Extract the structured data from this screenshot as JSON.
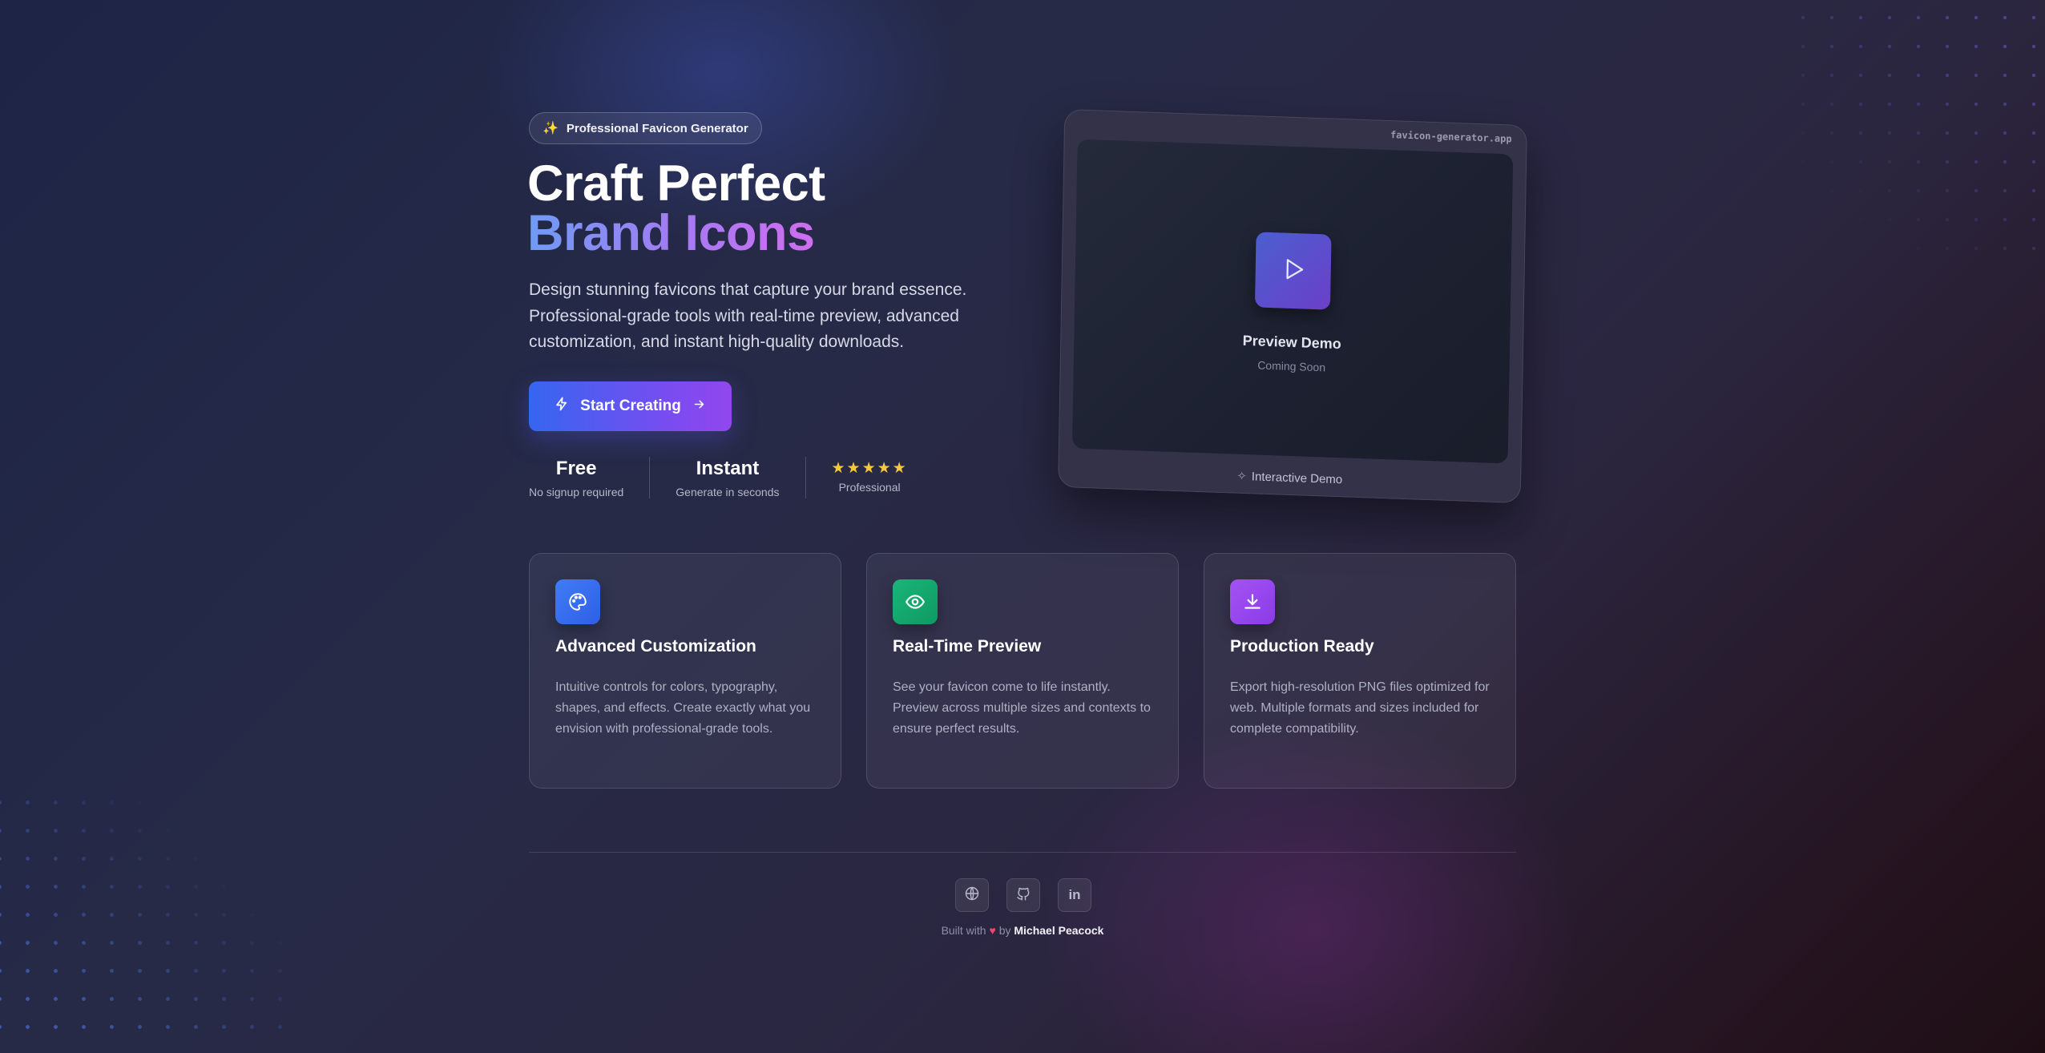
{
  "badge": {
    "icon": "sparkles-icon",
    "label": "Professional Favicon Generator"
  },
  "hero": {
    "title_line1": "Craft Perfect",
    "title_line2": "Brand Icons",
    "description": "Design stunning favicons that capture your brand essence. Professional-grade tools with real-time preview, advanced customization, and instant high-quality downloads."
  },
  "cta": {
    "label": "Start Creating",
    "icon_left": "zap-icon",
    "icon_right": "arrow-right-icon"
  },
  "stats": [
    {
      "big": "Free",
      "small": "No signup required"
    },
    {
      "big": "Instant",
      "small": "Generate in seconds"
    },
    {
      "stars": 5,
      "small": "Professional"
    }
  ],
  "demo": {
    "url": "favicon-generator.app",
    "title": "Preview Demo",
    "subtitle": "Coming Soon",
    "footer": "Interactive Demo"
  },
  "features": [
    {
      "icon": "palette-icon",
      "color": "#3b6ef2",
      "title": "Advanced Customization",
      "text": "Intuitive controls for colors, typography, shapes, and effects. Create exactly what you envision with professional-grade tools."
    },
    {
      "icon": "eye-icon",
      "color": "#14a86f",
      "title": "Real-Time Preview",
      "text": "See your favicon come to life instantly. Preview across multiple sizes and contexts to ensure perfect results."
    },
    {
      "icon": "download-icon",
      "color": "#9646ee",
      "title": "Production Ready",
      "text": "Export high-resolution PNG files optimized for web. Multiple formats and sizes included for complete compatibility."
    }
  ],
  "footer": {
    "social": [
      "globe-icon",
      "github-icon",
      "linkedin-icon"
    ],
    "built_with": "Built with",
    "by": "by",
    "author": "Michael Peacock"
  }
}
